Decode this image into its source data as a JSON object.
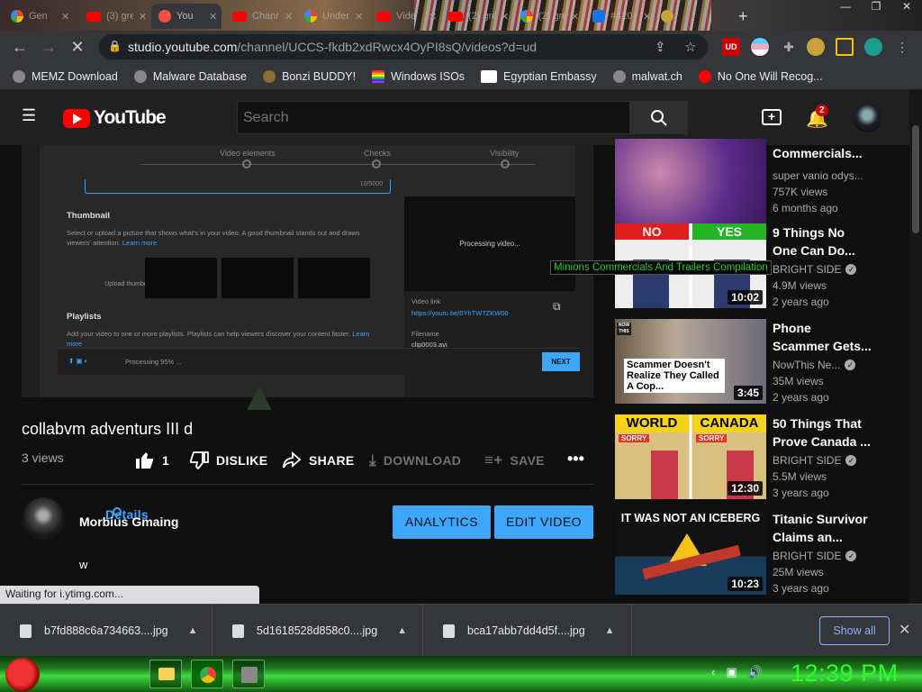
{
  "browser": {
    "tabs": [
      {
        "title": "Gen",
        "icon": "google-icon"
      },
      {
        "title": "(3) gre",
        "icon": "youtube-icon"
      },
      {
        "title": "You",
        "icon": "youtube-studio-icon",
        "active": true
      },
      {
        "title": "Chann",
        "icon": "youtube-icon"
      },
      {
        "title": "Under",
        "icon": "google-icon"
      },
      {
        "title": "Vide",
        "icon": "youtube-icon"
      },
      {
        "title": "(2) gre",
        "icon": "youtube-icon"
      },
      {
        "title": "(2) gre",
        "icon": "google-icon"
      },
      {
        "title": "#420",
        "icon": "edge-icon"
      },
      {
        "title": "",
        "icon": "extension-icon"
      }
    ],
    "window_controls": [
      "—",
      "❐",
      "✕"
    ],
    "url_host": "studio.youtube.com",
    "url_path": "/channel/UCCS-fkdb2xdRwcx4OyPI8sQ/videos?d=ud",
    "bookmarks": [
      "MEMZ Download",
      "Malware Database",
      "Bonzi BUDDY!",
      "Windows ISOs",
      "Egyptian Embassy",
      "malwat.ch",
      "No One Will Recog..."
    ],
    "status_text": "Waiting for i.ytimg.com..."
  },
  "header": {
    "logo_text": "YouTube",
    "search_placeholder": "Search",
    "notification_count": "2"
  },
  "upload_dialog": {
    "steps": [
      "Details",
      "Video elements",
      "Checks",
      "Visibility"
    ],
    "desc_count": "10/5000",
    "thumbnail_title": "Thumbnail",
    "thumbnail_text": "Select or upload a picture that shows what's in your video. A good thumbnail stands out and draws viewers' attention.",
    "thumbnail_link": "Learn more",
    "upload_thumbnail": "Upload thumbnail",
    "playlists_title": "Playlists",
    "playlists_text": "Add your video to one or more playlists. Playlists can help viewers discover your content faster.",
    "playlists_link": "Learn more",
    "processing_text": "Processing video...",
    "video_link_label": "Video link",
    "video_link": "https://youtu.be/0YhTW7ZKW00",
    "filename_label": "Filename",
    "filename": "clip0003.avi",
    "processing_status": "Processing 95% ...",
    "next_label": "NEXT"
  },
  "video": {
    "title": "collabvm adventurs III d",
    "views": "3 views",
    "likes": "1",
    "dislike_label": "DISLIKE",
    "share_label": "SHARE",
    "download_label": "DOWNLOAD",
    "save_label": "SAVE",
    "more_label": "•••",
    "channel_name": "Morbius Gmaing",
    "analytics_label": "ANALYTICS",
    "edit_label": "EDIT VIDEO",
    "description": "w"
  },
  "tooltip": "Minions Commercials And Trailers Compilation",
  "sidebar": [
    {
      "title1": "Commercials...",
      "title2": "",
      "channel": "super vanio odys...",
      "verified": false,
      "views": "757K views",
      "age": "6 months ago",
      "duration": ""
    },
    {
      "title1": "9 Things No",
      "title2": "One Can Do...",
      "channel": "BRIGHT SIDE",
      "verified": true,
      "views": "4.9M views",
      "age": "2 years ago",
      "duration": "10:02",
      "overlay_left": "NO",
      "overlay_right": "YES"
    },
    {
      "title1": "Phone",
      "title2": "Scammer Gets...",
      "channel": "NowThis Ne...",
      "verified": true,
      "views": "35M views",
      "age": "2 years ago",
      "duration": "3:45",
      "overlay": "Scammer Doesn't Realize They Called A Cop...",
      "overlay_badge": "NOW THIS"
    },
    {
      "title1": "50 Things That",
      "title2": "Prove Canada ...",
      "channel": "BRIGHT SIDE",
      "verified": true,
      "views": "5.5M views",
      "age": "3 years ago",
      "duration": "12:30",
      "overlay_left": "WORLD",
      "overlay_right": "CANADA",
      "badge": "SORRY"
    },
    {
      "title1": "Titanic Survivor",
      "title2": "Claims an...",
      "channel": "BRIGHT SIDE",
      "verified": true,
      "views": "25M views",
      "age": "3 years ago",
      "duration": "10:23",
      "overlay": "IT WAS NOT AN ICEBERG"
    }
  ],
  "downloads": {
    "items": [
      "b7fd888c6a734663....jpg",
      "5d1618528d858c0....jpg",
      "bca17abb7dd4d5f....jpg"
    ],
    "show_all": "Show all",
    "close": "✕"
  },
  "taskbar": {
    "time": "12:39 PM"
  }
}
